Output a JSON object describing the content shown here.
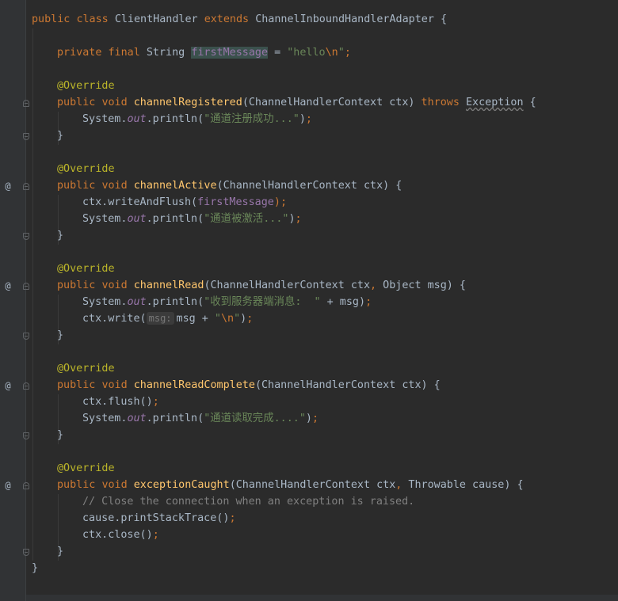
{
  "editor": {
    "gutter_marker": "@",
    "class_decl": {
      "kw_public": "public",
      "kw_class": "class",
      "class_name": "ClientHandler",
      "kw_extends": "extends",
      "super_name": "ChannelInboundHandlerAdapter",
      "brace": "{"
    },
    "field_decl": {
      "kw_private": "private",
      "kw_final": "final",
      "type": "String",
      "name": "firstMessage",
      "eq": "=",
      "str_start": "\"hello",
      "str_escape": "\\n",
      "str_end": "\"",
      "semicolon": ";"
    },
    "annotation": "@Override",
    "kw_public": "public",
    "kw_void": "void",
    "close_brace": "}",
    "methods": [
      {
        "name": "channelRegistered",
        "params": "(ChannelHandlerContext ctx)",
        "kw_throws": "throws",
        "throws_type": "Exception",
        "open": "{",
        "body": [
          {
            "p1": "System.",
            "field": "out",
            "p2": ".println(",
            "str": "\"通道注册成功...\"",
            "p3": ");"
          }
        ]
      },
      {
        "name": "channelActive",
        "params": "(ChannelHandlerContext ctx)",
        "open": "{",
        "body": [
          {
            "p1": "ctx.writeAndFlush(",
            "field": "firstMessage",
            "p3": ");"
          },
          {
            "p1": "System.",
            "field": "out",
            "p2": ".println(",
            "str": "\"通道被激活...\"",
            "p3": ");"
          }
        ]
      },
      {
        "name": "channelRead",
        "params_a": "(ChannelHandlerContext ctx",
        "comma": ",",
        "params_b": " Object msg)",
        "open": "{",
        "body": [
          {
            "p1": "System.",
            "field": "out",
            "p2": ".println(",
            "str": "\"收到服务器端消息:  \"",
            "p3": " + msg);"
          },
          {
            "p1": "ctx.write(",
            "hint": "msg:",
            "p2": "msg + ",
            "str_start": "\"",
            "str_escape": "\\n",
            "str_end": "\"",
            "p3": ");"
          }
        ]
      },
      {
        "name": "channelReadComplete",
        "params": "(ChannelHandlerContext ctx)",
        "open": "{",
        "body": [
          {
            "p1": "ctx.flush();"
          },
          {
            "p1": "System.",
            "field": "out",
            "p2": ".println(",
            "str": "\"通道读取完成....\"",
            "p3": ");"
          }
        ]
      },
      {
        "name": "exceptionCaught",
        "params_a": "(ChannelHandlerContext ctx",
        "comma": ",",
        "params_b": " Throwable cause)",
        "open": "{",
        "body": [
          {
            "comment": "// Close the connection when an exception is raised."
          },
          {
            "p1": "cause.printStackTrace();"
          },
          {
            "p1": "ctx.close();"
          }
        ]
      }
    ]
  }
}
